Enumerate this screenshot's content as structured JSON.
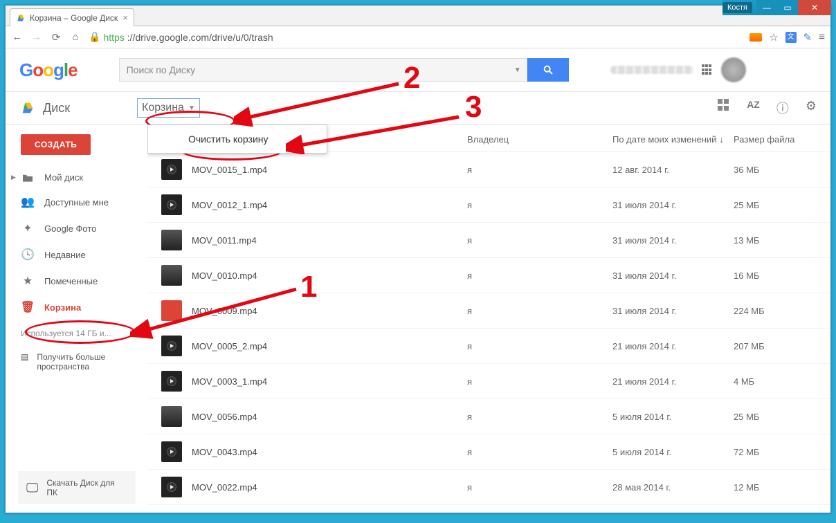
{
  "window": {
    "user": "Костя"
  },
  "tab": {
    "title": "Корзина – Google Диск"
  },
  "url": {
    "scheme": "https",
    "host_path": "://drive.google.com/drive/u/0/trash"
  },
  "logo": {
    "g": "G",
    "o1": "o",
    "o2": "o",
    "g2": "g",
    "l": "l",
    "e": "e"
  },
  "search": {
    "placeholder": "Поиск по Диску"
  },
  "drive": {
    "label": "Диск"
  },
  "breadcrumb": {
    "label": "Корзина"
  },
  "dropdown": {
    "empty_trash": "Очистить корзину"
  },
  "columns": {
    "owner": "Владелец",
    "date": "По дате моих изменений",
    "size": "Размер файла"
  },
  "sidebar": {
    "create": "СОЗДАТЬ",
    "items": [
      {
        "label": "Мой диск",
        "icon": "folder"
      },
      {
        "label": "Доступные мне",
        "icon": "people"
      },
      {
        "label": "Google Фото",
        "icon": "photos"
      },
      {
        "label": "Недавние",
        "icon": "clock"
      },
      {
        "label": "Помеченные",
        "icon": "star"
      },
      {
        "label": "Корзина",
        "icon": "trash"
      }
    ],
    "storage": "Используется 14 ГБ и...",
    "more_storage": "Получить больше пространства",
    "download": "Скачать Диск для ПК"
  },
  "files": [
    {
      "name": "MOV_0015_1.mp4",
      "owner": "я",
      "date": "12 авг. 2014 г.",
      "size": "36 МБ",
      "t": "v"
    },
    {
      "name": "MOV_0012_1.mp4",
      "owner": "я",
      "date": "31 июля 2014 г.",
      "size": "25 МБ",
      "t": "v"
    },
    {
      "name": "MOV_0011.mp4",
      "owner": "я",
      "date": "31 июля 2014 г.",
      "size": "13 МБ",
      "t": "p"
    },
    {
      "name": "MOV_0010.mp4",
      "owner": "я",
      "date": "31 июля 2014 г.",
      "size": "16 МБ",
      "t": "p"
    },
    {
      "name": "MOV_0009.mp4",
      "owner": "я",
      "date": "31 июля 2014 г.",
      "size": "224 МБ",
      "t": "r"
    },
    {
      "name": "MOV_0005_2.mp4",
      "owner": "я",
      "date": "21 июля 2014 г.",
      "size": "207 МБ",
      "t": "v"
    },
    {
      "name": "MOV_0003_1.mp4",
      "owner": "я",
      "date": "21 июля 2014 г.",
      "size": "4 МБ",
      "t": "v"
    },
    {
      "name": "MOV_0056.mp4",
      "owner": "я",
      "date": "5 июля 2014 г.",
      "size": "25 МБ",
      "t": "p"
    },
    {
      "name": "MOV_0043.mp4",
      "owner": "я",
      "date": "5 июля 2014 г.",
      "size": "72 МБ",
      "t": "v"
    },
    {
      "name": "MOV_0022.mp4",
      "owner": "я",
      "date": "28 мая 2014 г.",
      "size": "12 МБ",
      "t": "v"
    }
  ],
  "annotations": {
    "n1": "1",
    "n2": "2",
    "n3": "3"
  }
}
